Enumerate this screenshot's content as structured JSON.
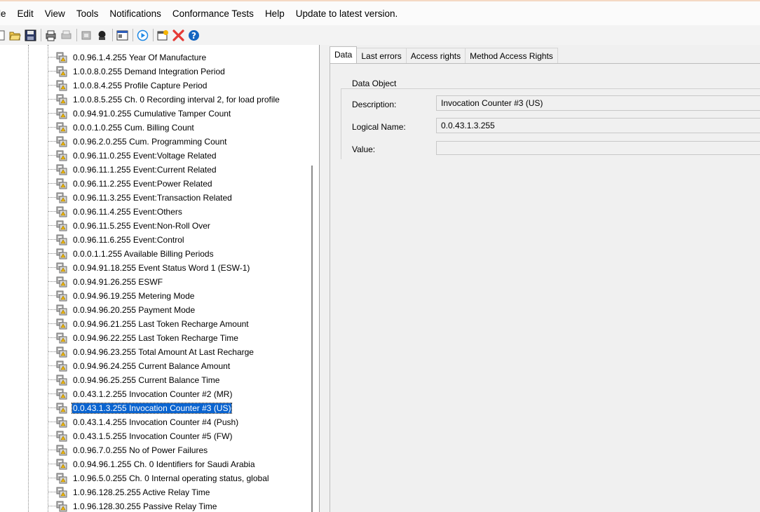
{
  "menu": {
    "items": [
      "le",
      "Edit",
      "View",
      "Tools",
      "Notifications",
      "Conformance Tests",
      "Help",
      "Update to latest version."
    ]
  },
  "toolbar": {
    "icons": [
      "open-folder-icon",
      "save-icon",
      "print-icon",
      "print-preview-icon",
      "connect-icon",
      "disconnect-icon",
      "properties-icon",
      "play-icon",
      "add-icon",
      "delete-icon",
      "help-icon"
    ]
  },
  "tree": {
    "items": [
      {
        "label": "0.0.96.1.4.255 Year Of Manufacture"
      },
      {
        "label": "1.0.0.8.0.255 Demand Integration Period"
      },
      {
        "label": "1.0.0.8.4.255 Profile Capture Period"
      },
      {
        "label": "1.0.0.8.5.255 Ch. 0 Recording interval 2, for load profile"
      },
      {
        "label": "0.0.94.91.0.255 Cumulative Tamper Count"
      },
      {
        "label": "0.0.0.1.0.255 Cum. Billing Count"
      },
      {
        "label": "0.0.96.2.0.255 Cum. Programming Count"
      },
      {
        "label": "0.0.96.11.0.255 Event:Voltage Related"
      },
      {
        "label": "0.0.96.11.1.255 Event:Current Related"
      },
      {
        "label": "0.0.96.11.2.255 Event:Power Related"
      },
      {
        "label": "0.0.96.11.3.255 Event:Transaction Related"
      },
      {
        "label": "0.0.96.11.4.255 Event:Others"
      },
      {
        "label": "0.0.96.11.5.255 Event:Non-Roll Over"
      },
      {
        "label": "0.0.96.11.6.255 Event:Control"
      },
      {
        "label": "0.0.0.1.1.255 Available Billing Periods"
      },
      {
        "label": "0.0.94.91.18.255 Event Status Word 1 (ESW-1)"
      },
      {
        "label": "0.0.94.91.26.255 ESWF"
      },
      {
        "label": "0.0.94.96.19.255 Metering Mode"
      },
      {
        "label": "0.0.94.96.20.255 Payment Mode"
      },
      {
        "label": "0.0.94.96.21.255 Last Token Recharge Amount"
      },
      {
        "label": "0.0.94.96.22.255 Last Token Recharge Time"
      },
      {
        "label": "0.0.94.96.23.255 Total Amount At Last Recharge"
      },
      {
        "label": "0.0.94.96.24.255 Current Balance Amount"
      },
      {
        "label": "0.0.94.96.25.255 Current Balance Time"
      },
      {
        "label": "0.0.43.1.2.255 Invocation Counter #2 (MR)"
      },
      {
        "label": "0.0.43.1.3.255 Invocation Counter #3 (US)"
      },
      {
        "label": "0.0.43.1.4.255 Invocation Counter #4 (Push)"
      },
      {
        "label": "0.0.43.1.5.255 Invocation Counter #5 (FW)"
      },
      {
        "label": "0.0.96.7.0.255 No of Power Failures"
      },
      {
        "label": "0.0.94.96.1.255 Ch. 0 Identifiers for Saudi Arabia"
      },
      {
        "label": "1.0.96.5.0.255 Ch. 0 Internal operating status, global"
      },
      {
        "label": "1.0.96.128.25.255 Active Relay Time"
      },
      {
        "label": "1.0.96.128.30.255 Passive Relay Time"
      }
    ],
    "selected_index": 25
  },
  "tabs": [
    "Data",
    "Last errors",
    "Access rights",
    "Method Access Rights"
  ],
  "active_tab": "Data",
  "data_object": {
    "group_title": "Data Object",
    "description_label": "Description:",
    "description_value": "Invocation Counter #3 (US)",
    "logical_name_label": "Logical Name:",
    "logical_name_value": "0.0.43.1.3.255",
    "value_label": "Value:",
    "value_value": ""
  }
}
